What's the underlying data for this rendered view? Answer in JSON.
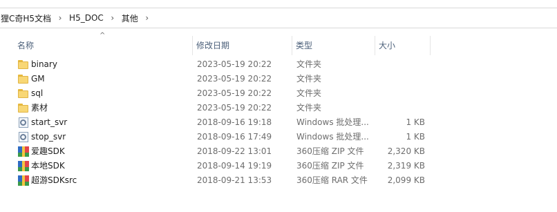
{
  "breadcrumb": [
    {
      "label": "狸C奇H5文档"
    },
    {
      "label": "H5_DOC"
    },
    {
      "label": "其他"
    }
  ],
  "columns": {
    "name": "名称",
    "date": "修改日期",
    "type": "类型",
    "size": "大小"
  },
  "files": [
    {
      "name": "binary",
      "date": "2023-05-19 20:22",
      "type": "文件夹",
      "size": "",
      "icon": "folder-icon"
    },
    {
      "name": "GM",
      "date": "2023-05-19 20:22",
      "type": "文件夹",
      "size": "",
      "icon": "folder-icon"
    },
    {
      "name": "sql",
      "date": "2023-05-19 20:22",
      "type": "文件夹",
      "size": "",
      "icon": "folder-icon"
    },
    {
      "name": "素材",
      "date": "2023-05-19 20:22",
      "type": "文件夹",
      "size": "",
      "icon": "folder-icon"
    },
    {
      "name": "start_svr",
      "date": "2018-09-16 19:18",
      "type": "Windows 批处理...",
      "size": "1 KB",
      "icon": "batch-file-icon"
    },
    {
      "name": "stop_svr",
      "date": "2018-09-16 17:49",
      "type": "Windows 批处理...",
      "size": "1 KB",
      "icon": "batch-file-icon"
    },
    {
      "name": "爱趣SDK",
      "date": "2018-09-22 13:01",
      "type": "360压缩 ZIP 文件",
      "size": "2,320 KB",
      "icon": "archive-icon"
    },
    {
      "name": "本地SDK",
      "date": "2018-09-14 19:19",
      "type": "360压缩 ZIP 文件",
      "size": "2,319 KB",
      "icon": "archive-icon"
    },
    {
      "name": "超游SDKsrc",
      "date": "2018-09-21 13:53",
      "type": "360压缩 RAR 文件",
      "size": "2,099 KB",
      "icon": "archive-icon"
    }
  ]
}
